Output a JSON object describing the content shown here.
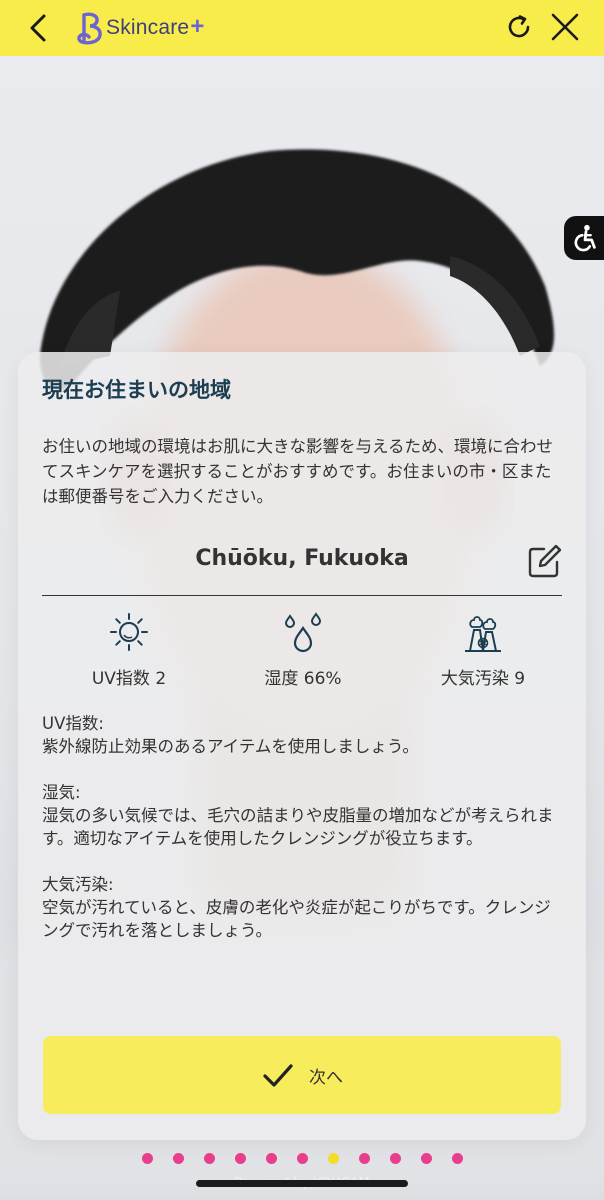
{
  "header": {
    "brand_name": "Skincare",
    "brand_plus": "+",
    "icons": [
      "chevron-left-icon",
      "logo-icon",
      "refresh-icon",
      "close-icon"
    ],
    "background_color": "#f7ec4a"
  },
  "card": {
    "title": "現在お住まいの地域",
    "description": "お住いの地域の環境はお肌に大きな影響を与えるため、環境に合わせてスキンケアを選択することがおすすめです。お住まいの市・区または郵便番号をご入力ください。",
    "location": "Chūōku, Fukuoka",
    "metrics": [
      {
        "icon": "sun-icon",
        "label": "UV指数 2"
      },
      {
        "icon": "water-drops-icon",
        "label": "湿度 66%"
      },
      {
        "icon": "factory-smoke-icon",
        "label": "大気汚染 9"
      }
    ],
    "advice": {
      "uv": {
        "heading": "UV指数:",
        "text": "紫外線防止効果のあるアイテムを使用しましょう。"
      },
      "humidity": {
        "heading": "湿気:",
        "text": "湿気の多い気候では、毛穴の詰まりや皮脂量の増加などが考えられます。適切なアイテムを使用したクレンジングが役立ちます。"
      },
      "pollution": {
        "heading": "大気汚染:",
        "text": "空気が汚れていると、皮膚の老化や炎症が起こりがちです。クレンジングで汚れを落としましょう。"
      }
    },
    "next_button": "次へ"
  },
  "pagination": {
    "total": 11,
    "active_index": 6,
    "dot_color": "#e83e8c",
    "active_color": "#f2dd2a"
  },
  "footer": {
    "powered_by": "Powered by YOUCAM"
  }
}
